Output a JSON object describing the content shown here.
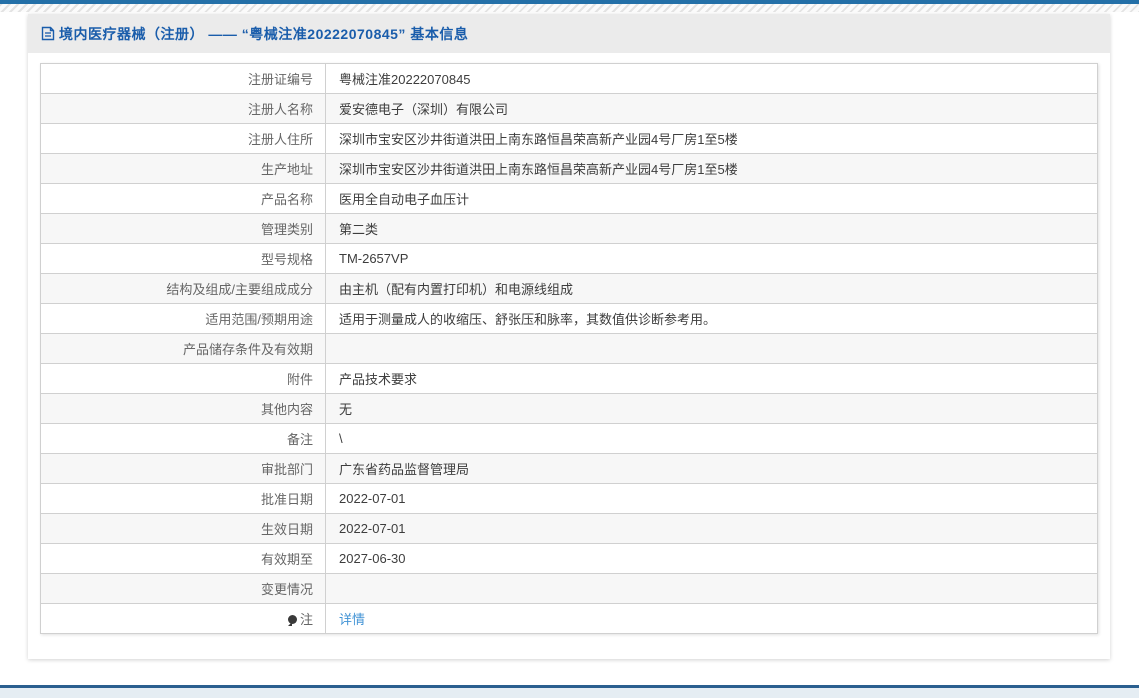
{
  "header": {
    "title": "境内医疗器械（注册） —— “粤械注准20222070845” 基本信息"
  },
  "table": {
    "rows": [
      {
        "label": "注册证编号",
        "value": "粤械注准20222070845"
      },
      {
        "label": "注册人名称",
        "value": "爱安德电子（深圳）有限公司"
      },
      {
        "label": "注册人住所",
        "value": "深圳市宝安区沙井街道洪田上南东路恒昌荣高新产业园4号厂房1至5楼"
      },
      {
        "label": "生产地址",
        "value": "深圳市宝安区沙井街道洪田上南东路恒昌荣高新产业园4号厂房1至5楼"
      },
      {
        "label": "产品名称",
        "value": "医用全自动电子血压计"
      },
      {
        "label": "管理类别",
        "value": "第二类"
      },
      {
        "label": "型号规格",
        "value": "TM-2657VP"
      },
      {
        "label": "结构及组成/主要组成成分",
        "value": "由主机（配有内置打印机）和电源线组成"
      },
      {
        "label": "适用范围/预期用途",
        "value": "适用于测量成人的收缩压、舒张压和脉率，其数值供诊断参考用。"
      },
      {
        "label": "产品储存条件及有效期",
        "value": ""
      },
      {
        "label": "附件",
        "value": "产品技术要求"
      },
      {
        "label": "其他内容",
        "value": "无"
      },
      {
        "label": "备注",
        "value": "\\"
      },
      {
        "label": "审批部门",
        "value": "广东省药品监督管理局"
      },
      {
        "label": "批准日期",
        "value": "2022-07-01"
      },
      {
        "label": "生效日期",
        "value": "2022-07-01"
      },
      {
        "label": "有效期至",
        "value": "2027-06-30"
      },
      {
        "label": "变更情况",
        "value": ""
      },
      {
        "label": "注",
        "value": "详情",
        "link": true,
        "icon": "note-icon"
      }
    ]
  },
  "colors": {
    "topbar_blue": "#2470a8",
    "title_blue": "#1a5dab",
    "link_blue": "#4193d5",
    "header_strip_bg": "#ebebeb",
    "even_row_bg": "#f7f7f7",
    "footer_line": "#2a5f8f",
    "footer_bg": "#e5edf3"
  }
}
